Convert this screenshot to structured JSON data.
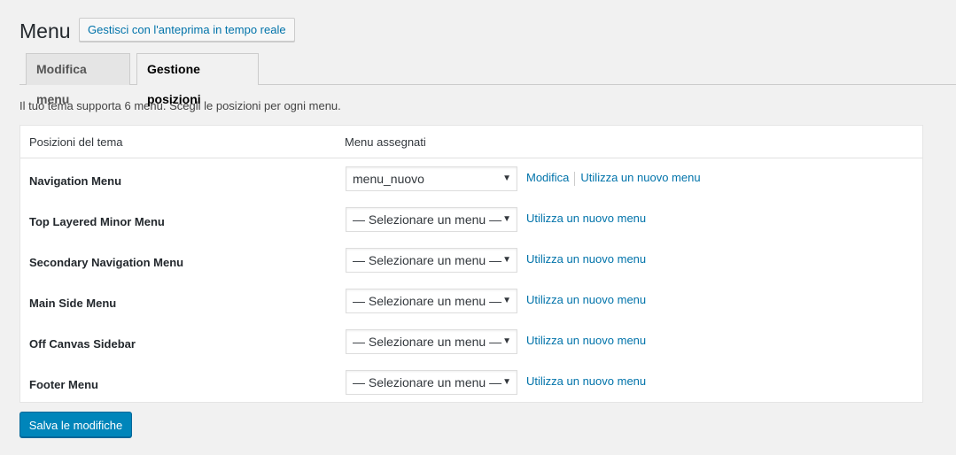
{
  "header": {
    "title": "Menu",
    "preview_button": "Gestisci con l'anteprima in tempo reale"
  },
  "tabs": [
    {
      "label": "Modifica menu",
      "active": false
    },
    {
      "label": "Gestione posizioni",
      "active": true
    }
  ],
  "intro": "Il tuo tema supporta 6 menu. Scegli le posizioni per ogni menu.",
  "table": {
    "col_location": "Posizioni del tema",
    "col_menu": "Menu assegnati",
    "rows": [
      {
        "location": "Navigation Menu",
        "selected": "menu_nuovo",
        "edit_link": "Modifica",
        "new_link": "Utilizza un nuovo menu"
      },
      {
        "location": "Top Layered Minor Menu",
        "selected": "— Selezionare un menu —",
        "new_link": "Utilizza un nuovo menu"
      },
      {
        "location": "Secondary Navigation Menu",
        "selected": "— Selezionare un menu —",
        "new_link": "Utilizza un nuovo menu"
      },
      {
        "location": "Main Side Menu",
        "selected": "— Selezionare un menu —",
        "new_link": "Utilizza un nuovo menu"
      },
      {
        "location": "Off Canvas Sidebar",
        "selected": "— Selezionare un menu —",
        "new_link": "Utilizza un nuovo menu"
      },
      {
        "location": "Footer Menu",
        "selected": "— Selezionare un menu —",
        "new_link": "Utilizza un nuovo menu"
      }
    ]
  },
  "save_button": "Salva le modifiche",
  "icons": {
    "dropdown": "chevron-down-icon"
  },
  "colors": {
    "accent": "#0073aa",
    "primary_button": "#0085ba"
  }
}
